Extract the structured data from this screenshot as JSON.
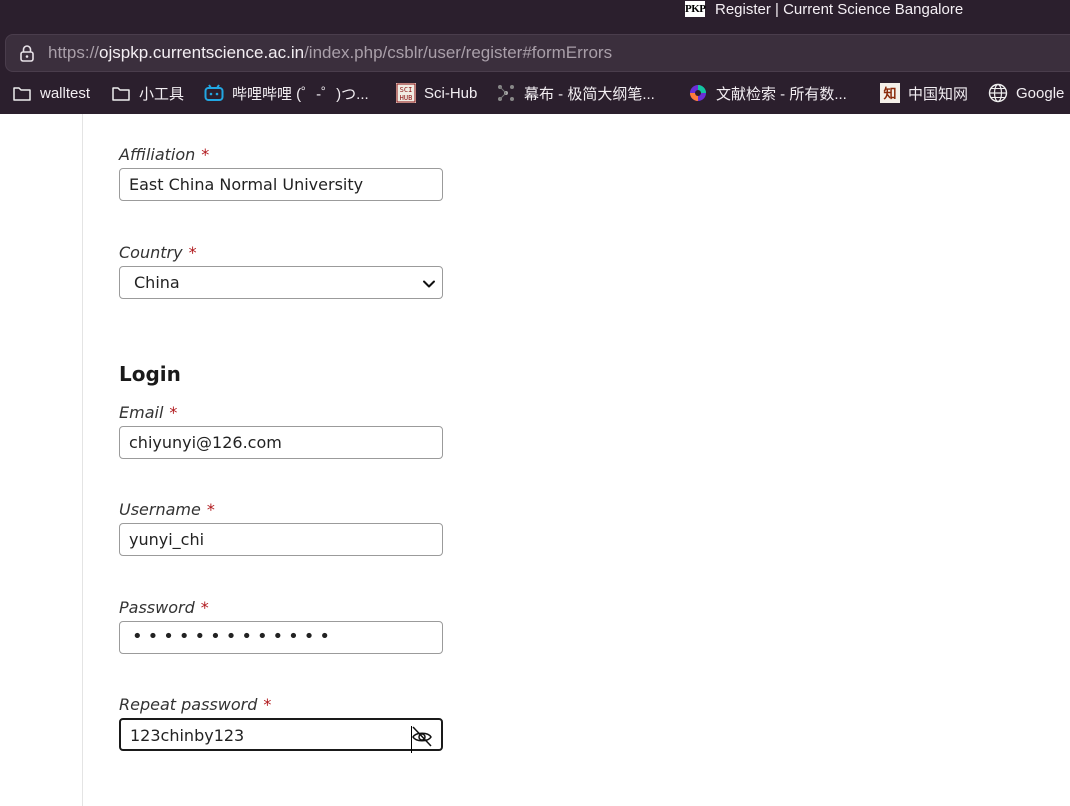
{
  "browser": {
    "tab": {
      "favicon_text": "PKP",
      "title": "Register | Current Science Bangalore"
    },
    "url": {
      "scheme": "https://",
      "host": "ojspkp.currentscience.ac.in",
      "path": "/index.php/csblr/user/register#formErrors"
    },
    "bookmarks": [
      {
        "label": "walltest",
        "icon": "folder-icon"
      },
      {
        "label": "小工具",
        "icon": "folder-icon"
      },
      {
        "label": "哔哩哔哩 (゜-゜)つ...",
        "icon": "bilibili-icon"
      },
      {
        "label": "Sci-Hub",
        "icon": "scihub-icon"
      },
      {
        "label": "幕布 - 极简大纲笔...",
        "icon": "mubu-icon"
      },
      {
        "label": "文献检索 - 所有数...",
        "icon": "lens-icon"
      },
      {
        "label": "中国知网",
        "icon": "cnki-icon"
      },
      {
        "label": "Google",
        "icon": "globe-icon"
      }
    ]
  },
  "form": {
    "required_marker": "*",
    "affiliation": {
      "label": "Affiliation",
      "value": "East China Normal University"
    },
    "country": {
      "label": "Country",
      "value": "China"
    },
    "login_section_title": "Login",
    "email": {
      "label": "Email",
      "value": "chiyunyi@126.com"
    },
    "username": {
      "label": "Username",
      "value": "yunyi_chi"
    },
    "password": {
      "label": "Password",
      "masked_value": "•••••••••••••"
    },
    "repeat_password": {
      "label": "Repeat password",
      "value": "123chinby123"
    }
  },
  "colors": {
    "chrome_bg": "#2b1f2d",
    "required": "#b0171b"
  }
}
